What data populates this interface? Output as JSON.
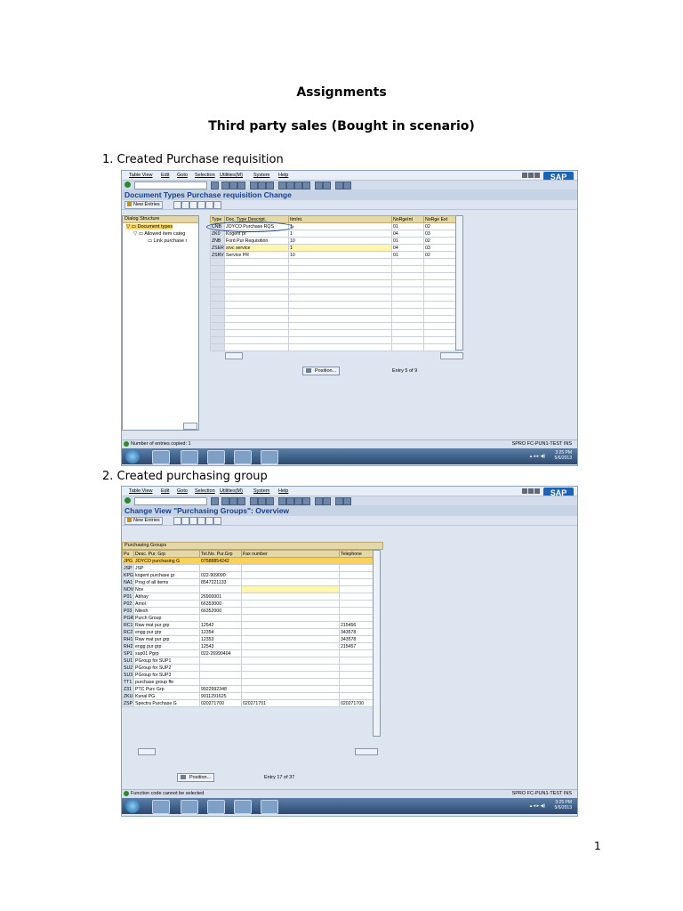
{
  "document": {
    "title": "Assignments",
    "subtitle": "Third party sales (Bought in scenario)",
    "page_number": "1",
    "sections": [
      {
        "heading": "1.   Created Purchase requisition"
      },
      {
        "heading": "2.   Created purchasing group"
      }
    ]
  },
  "menu": [
    "Table View",
    "Edit",
    "Goto",
    "Selection",
    "Utilities(M)",
    "System",
    "Help"
  ],
  "brand": "SAP",
  "screen1": {
    "title": "Document Types Purchase requisition Change",
    "new_entries": "New Entries",
    "tree_header": "Dialog Structure",
    "tree_nodes": [
      "Document types",
      "Allowed item categ",
      "Link purchase r"
    ],
    "columns": [
      "Type",
      "Doc. Type Descript.",
      "ItmInt.",
      "NoRgeInt",
      "NoRge Ext"
    ],
    "rows": [
      [
        "CNB",
        "JOYCO Purchase RQS",
        "1",
        "01",
        "02"
      ],
      [
        "ZK0",
        "Kogent pr",
        "1",
        "04",
        "03"
      ],
      [
        "ZNB",
        "Ford Pur Requisition",
        "10",
        "01",
        "02"
      ],
      [
        "ZSER",
        "srvc service",
        "1",
        "04",
        "03"
      ],
      [
        "ZSRV",
        "Service PR",
        "10",
        "01",
        "02"
      ]
    ],
    "position_label": "Position...",
    "entry_info": "Entry 5 of 9",
    "status_message": "Number of entries copied: 1",
    "status_info": "SPRO  FC-PUN1-TEST  INS",
    "clock_time": "3:25 PM",
    "clock_date": "5/6/2013"
  },
  "screen2": {
    "title": "Change View \"Purchasing Groups\": Overview",
    "new_entries": "New Entries",
    "table_caption": "Purchasing Groups",
    "columns": [
      "Pu",
      "Desc. Pur. Grp",
      "Tel.No. Pur.Grp",
      "Fax number",
      "Telephone"
    ],
    "rows": [
      [
        "JPG",
        "JOYCO purchasing G",
        "07588854242",
        "",
        ""
      ],
      [
        "JSP",
        "JSP",
        "",
        "",
        ""
      ],
      [
        "KPG",
        "kogent purchase gr",
        "022-909090",
        "",
        ""
      ],
      [
        "NA1",
        "Prog of all items",
        "8547221133",
        "",
        ""
      ],
      [
        "NOV",
        "Nov",
        "",
        "",
        ""
      ],
      [
        "P01",
        "Abhay",
        "26900001",
        "",
        ""
      ],
      [
        "P02",
        "Amol",
        "66353000",
        "",
        ""
      ],
      [
        "P03",
        "Nilesh",
        "66352000",
        "",
        ""
      ],
      [
        "PGR",
        "Purch Group",
        "",
        "",
        ""
      ],
      [
        "RC1",
        "Raw mat pur grp",
        "12542",
        "",
        "215456"
      ],
      [
        "RC2",
        "engg pur grp",
        "12354",
        "",
        "343578"
      ],
      [
        "RH1",
        "Raw mat pur grp",
        "12353",
        "",
        "343578"
      ],
      [
        "RH2",
        "engg pur grp",
        "12543",
        "",
        "215457"
      ],
      [
        "SP1",
        "sup01 Pgrp",
        "022-26990404",
        "",
        ""
      ],
      [
        "SU1",
        "PGroup for SUP1",
        "",
        "",
        ""
      ],
      [
        "SU2",
        "PGroup for SUP2",
        "",
        "",
        ""
      ],
      [
        "SU3",
        "PGroup for SUP3",
        "",
        "",
        ""
      ],
      [
        "TT1",
        "purchase group ffe",
        "",
        "",
        ""
      ],
      [
        "Z31",
        "PTC Purc Grp",
        "9922992348",
        "",
        ""
      ],
      [
        "ZKU",
        "Kunal PG",
        "9011291625",
        "",
        ""
      ],
      [
        "ZSP",
        "Spectra Purchase G",
        "020271700",
        "020271701",
        "020271700"
      ]
    ],
    "position_label": "Position...",
    "entry_info": "Entry 17 of 37",
    "status_message": "Function code cannot be selected",
    "status_info": "SPRO  FC-PUN1-TEST  INS",
    "clock_time": "3:25 PM",
    "clock_date": "5/6/2013"
  }
}
